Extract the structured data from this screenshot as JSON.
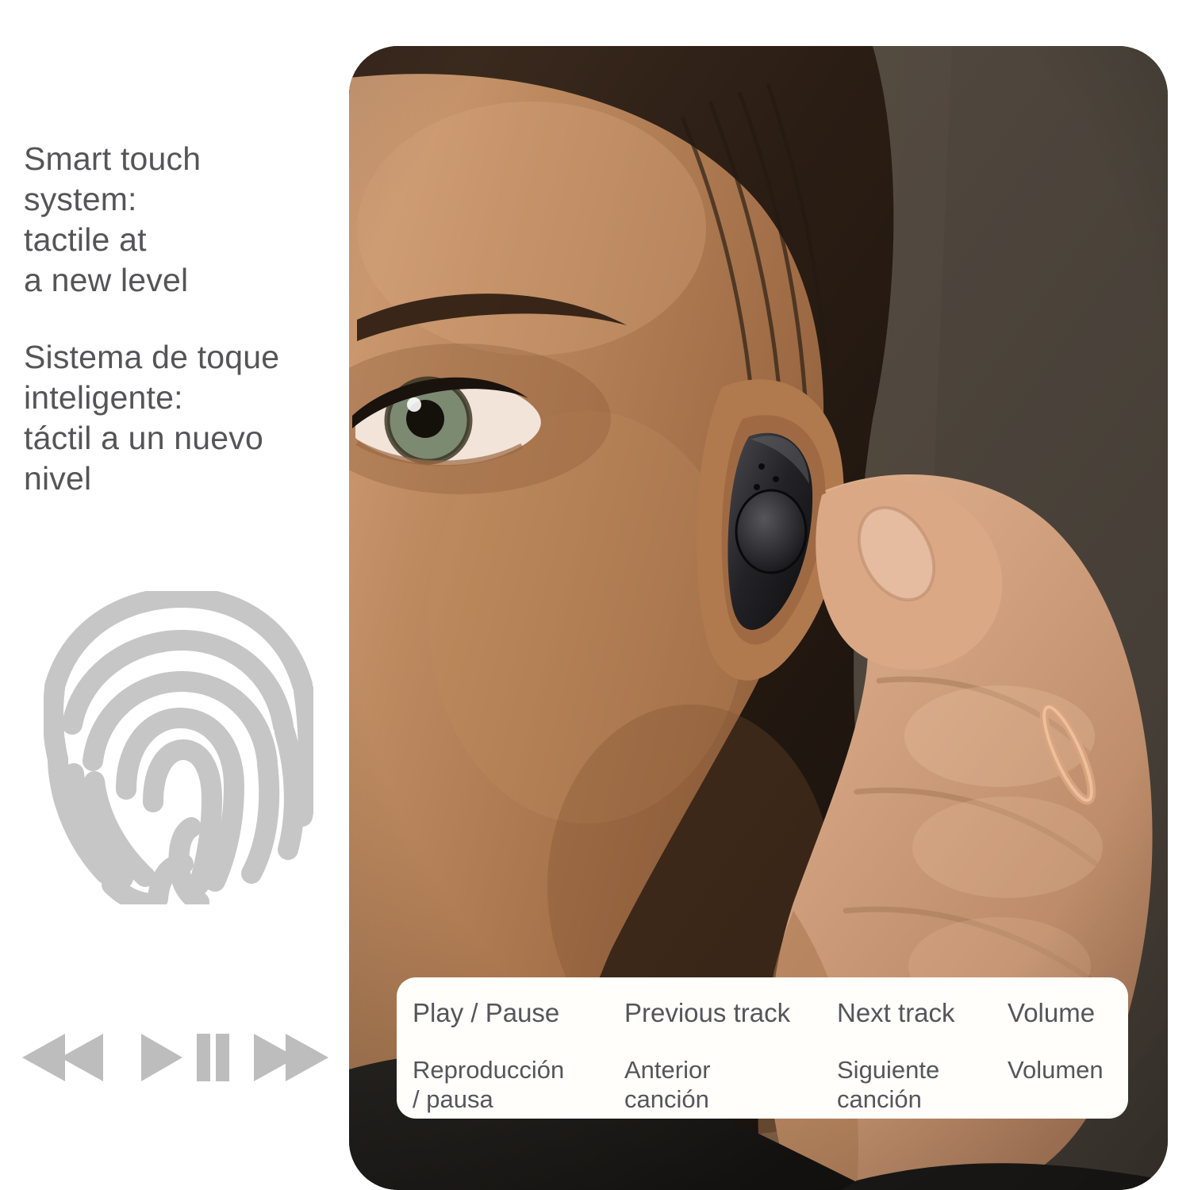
{
  "headline": {
    "english": [
      "Smart touch",
      "system:",
      "tactile at",
      "a new level"
    ],
    "spanish": [
      "Sistema de toque",
      "inteligente:",
      "táctil a un nuevo",
      "nivel"
    ]
  },
  "graphics": {
    "fingerprint_icon": "fingerprint-icon",
    "fingerprint_color": "#c6c6c6",
    "media_icons": [
      {
        "name": "rewind-icon",
        "glyph": "⏪"
      },
      {
        "name": "play-icon",
        "glyph": "▶"
      },
      {
        "name": "pause-icon",
        "glyph": "⏸"
      },
      {
        "name": "fast-forward-icon",
        "glyph": "⏩"
      }
    ],
    "media_icon_color": "#bdbdbd"
  },
  "photo": {
    "alt": "Woman touching wireless earbud in her ear",
    "earbud_label": "black-earbud",
    "wall_color": "#4a423a",
    "skin_color": "#b47c52",
    "hair_color": "#241a14",
    "sweater_color": "#1d1a18"
  },
  "caption": {
    "background": "#fffefb",
    "text_color": "#55565a",
    "columns": [
      {
        "english": "Play / Pause",
        "spanish": [
          "Reproducción",
          "/ pausa"
        ]
      },
      {
        "english": "Previous track",
        "spanish": [
          "Anterior",
          "canción"
        ]
      },
      {
        "english": "Next track",
        "spanish": [
          "Siguiente",
          "canción"
        ]
      },
      {
        "english": "Volume",
        "spanish": [
          "Volumen"
        ]
      }
    ]
  }
}
